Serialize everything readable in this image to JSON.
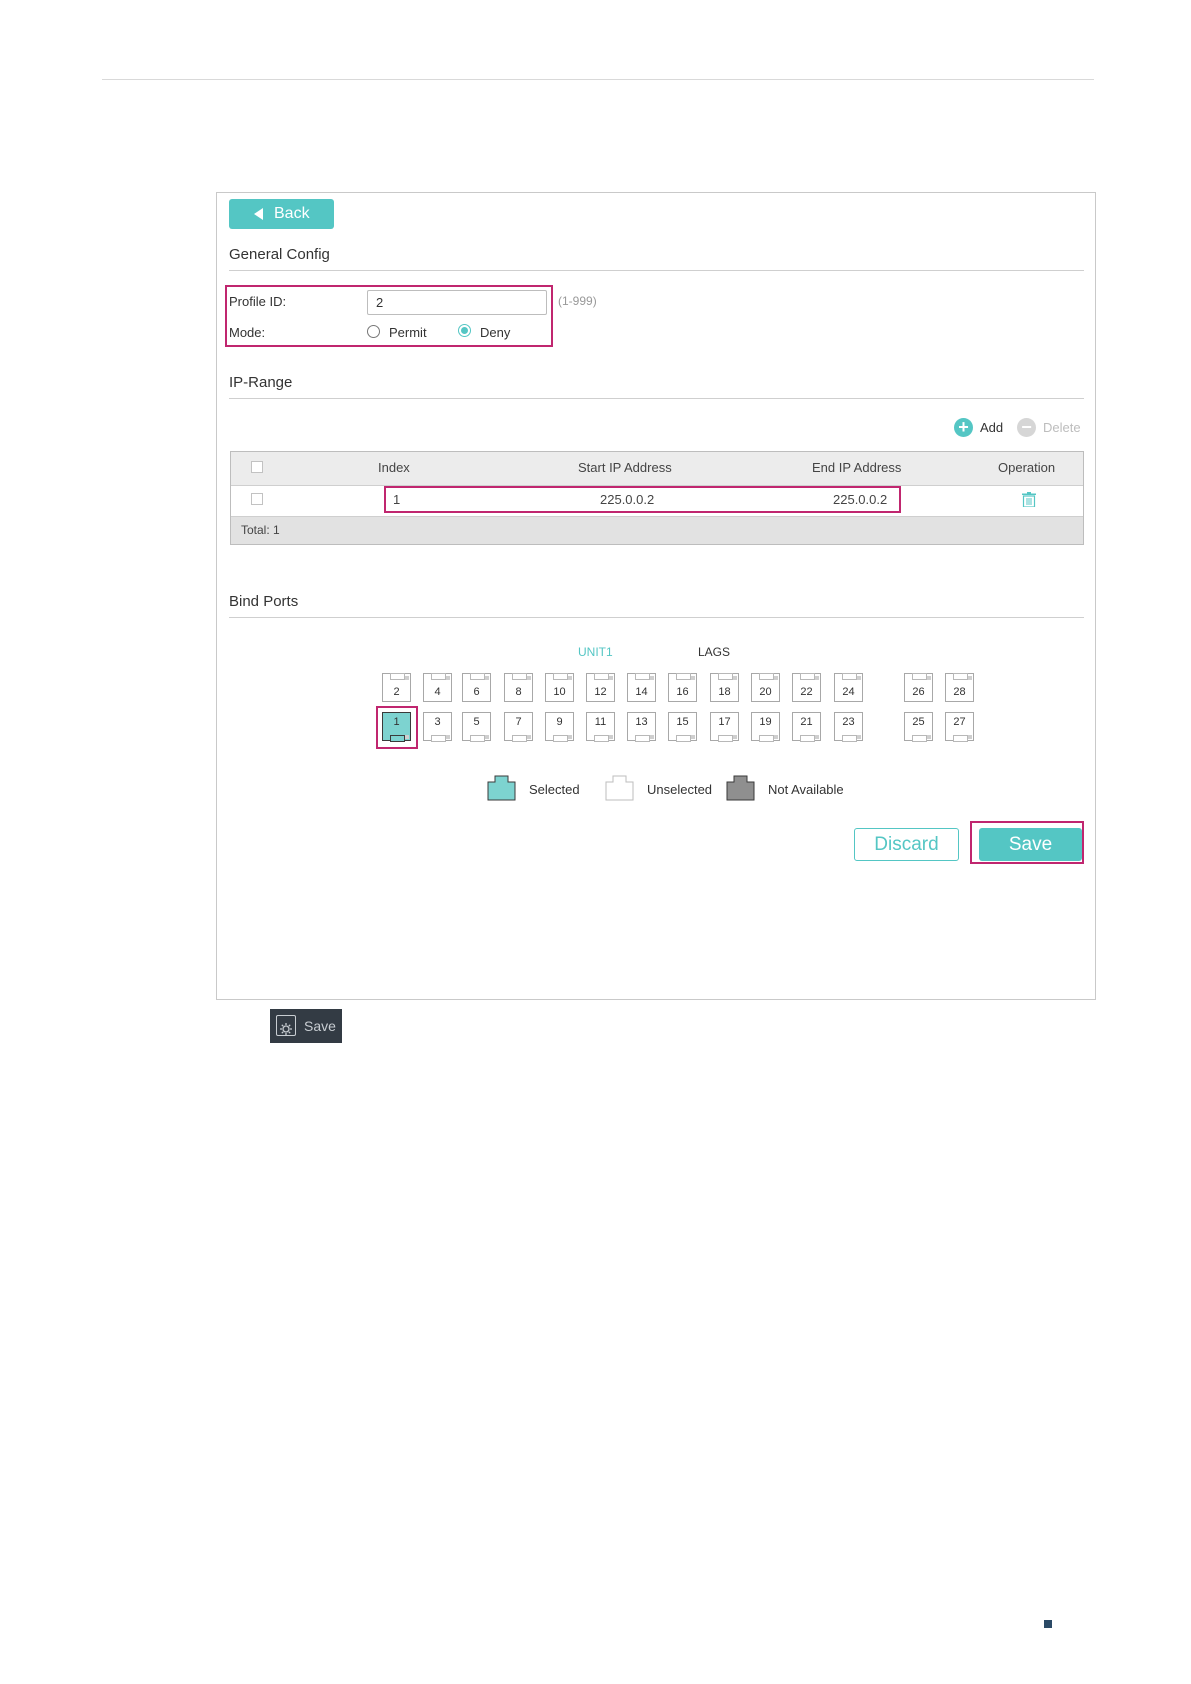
{
  "back_label": "Back",
  "general": {
    "title": "General Config",
    "profile_id_label": "Profile ID:",
    "profile_id_value": "2",
    "profile_id_hint": "(1-999)",
    "mode_label": "Mode:",
    "mode_options": [
      "Permit",
      "Deny"
    ],
    "mode_selected": "Deny"
  },
  "ip_range": {
    "title": "IP-Range",
    "add_label": "Add",
    "delete_label": "Delete",
    "columns": [
      "Index",
      "Start IP Address",
      "End IP Address",
      "Operation"
    ],
    "rows": [
      {
        "index": "1",
        "start_ip": "225.0.0.2",
        "end_ip": "225.0.0.2"
      }
    ],
    "total": "Total: 1"
  },
  "bind_ports": {
    "title": "Bind Ports",
    "unit_label": "UNIT1",
    "lags_label": "LAGS",
    "top_row": [
      "2",
      "4",
      "6",
      "8",
      "10",
      "12",
      "14",
      "16",
      "18",
      "20",
      "22",
      "24",
      "26",
      "28"
    ],
    "bottom_row": [
      "1",
      "3",
      "5",
      "7",
      "9",
      "11",
      "13",
      "15",
      "17",
      "19",
      "21",
      "23",
      "25",
      "27"
    ],
    "selected": [
      "1"
    ],
    "legend": [
      "Selected",
      "Unselected",
      "Not Available"
    ]
  },
  "buttons": {
    "discard": "Discard",
    "save": "Save"
  },
  "save_chip_label": "Save",
  "colors": {
    "accent": "#54c6c4",
    "highlight": "#c0266f",
    "chip_bg": "#333b44"
  },
  "icons": [
    "back-arrow-icon",
    "add-icon",
    "delete-icon",
    "trash-icon",
    "save-gear-icon"
  ]
}
